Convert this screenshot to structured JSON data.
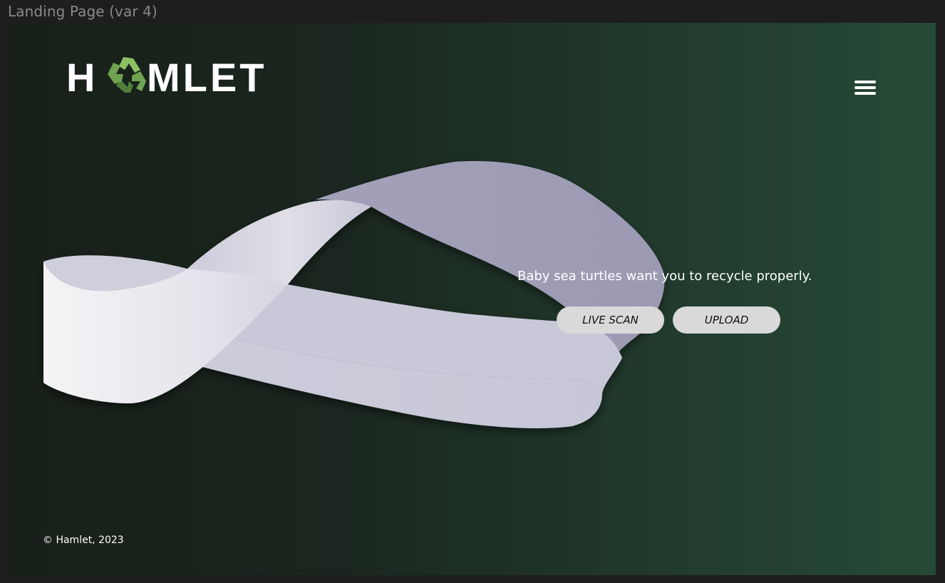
{
  "frame": {
    "label": "Landing Page (var 4)"
  },
  "brand": {
    "name": "HAMLET",
    "logo_text_left": "H",
    "logo_text_right": "MLET",
    "logo_icon": "recycle-icon",
    "logo_color": "#ffffff",
    "icon_colors": [
      "#6fa251",
      "#8cc063",
      "#4f7f3b"
    ]
  },
  "header": {
    "menu_icon": "hamburger-menu-icon"
  },
  "hero": {
    "tagline": "Baby sea turtles want you to recycle properly.",
    "primary_button": "LIVE SCAN",
    "secondary_button": "UPLOAD"
  },
  "footer": {
    "copyright": "© Hamlet, 2023"
  },
  "colors": {
    "background_start": "#172019",
    "background_end": "#264a36",
    "ribbon_light": "#c9c8d8",
    "ribbon_dark": "#9f9db6",
    "button_bg": "#d9d9d9",
    "text": "#ffffff"
  }
}
